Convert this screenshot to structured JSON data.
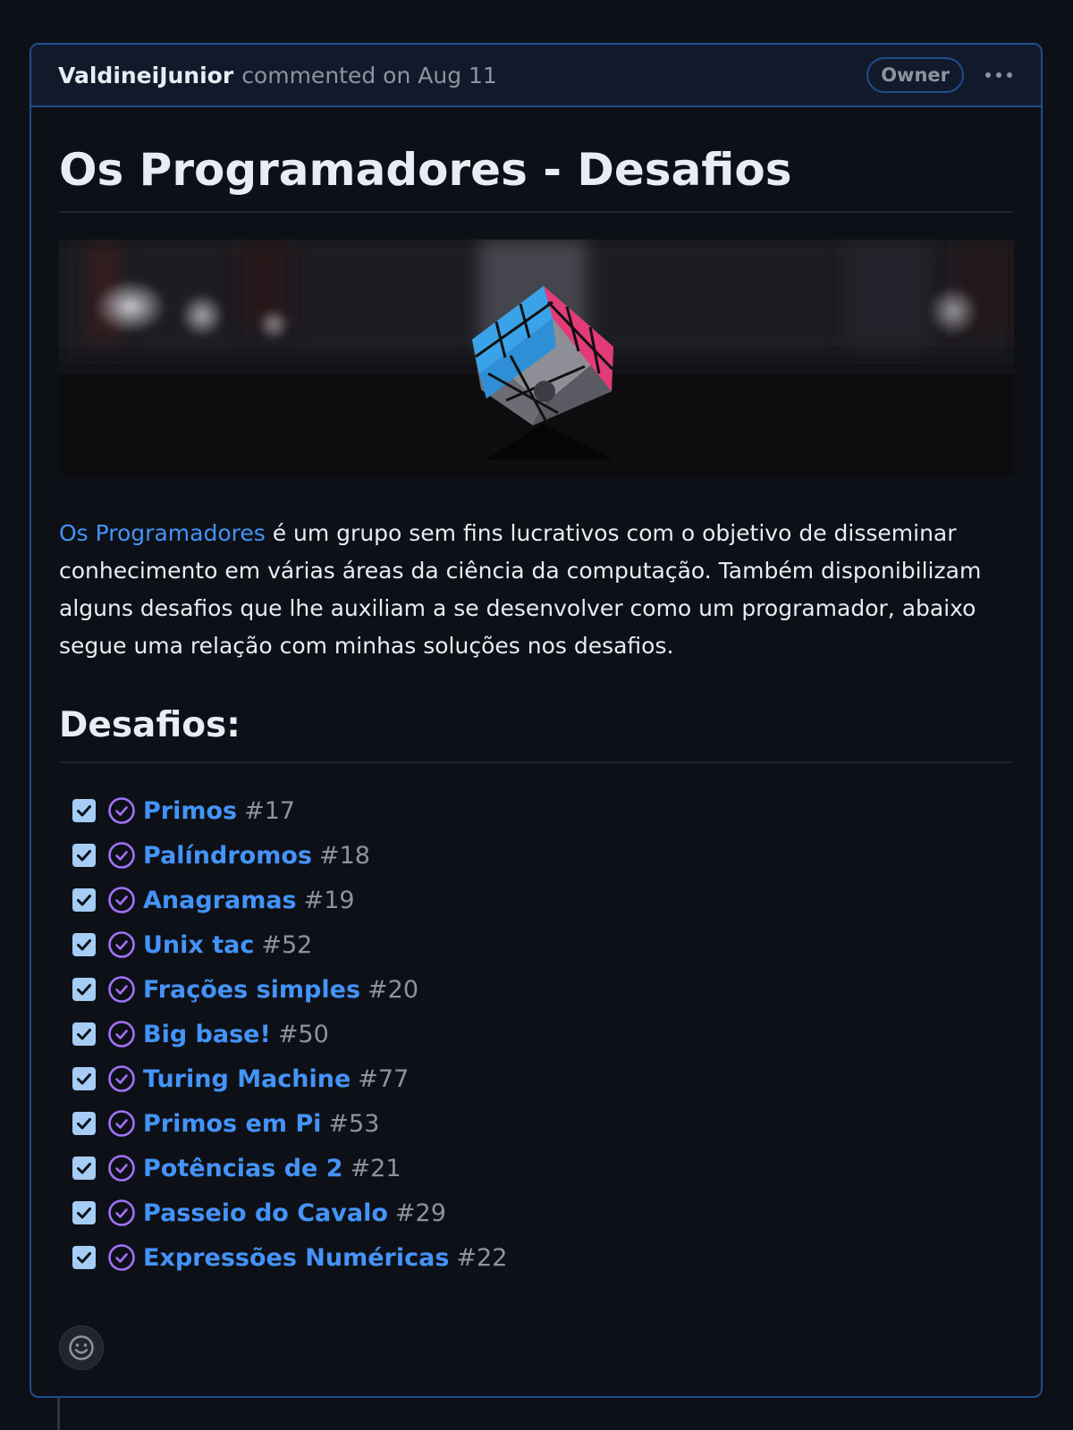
{
  "comment": {
    "author": "ValdineiJunior",
    "meta": "commented on Aug 11",
    "badge": "Owner",
    "more_icon": "kebab-horizontal-icon"
  },
  "content": {
    "title": "Os Programadores - Desafios",
    "hero_image": "rubiks-cube-photo",
    "intro_link": "Os Programadores",
    "intro_text": " é um grupo sem fins lucrativos com o objetivo de disseminar conhecimento em várias áreas da ciência da computação. Também disponibilizam alguns desafios que lhe auxiliam a se desenvolver como um programador, abaixo segue uma relação com minhas soluções nos desafios.",
    "section_title": "Desafios:"
  },
  "tasks": [
    {
      "title": "Primos",
      "number": "#17",
      "checked": true
    },
    {
      "title": "Palíndromos",
      "number": "#18",
      "checked": true
    },
    {
      "title": "Anagramas",
      "number": "#19",
      "checked": true
    },
    {
      "title": "Unix tac",
      "number": "#52",
      "checked": true
    },
    {
      "title": "Frações simples",
      "number": "#20",
      "checked": true
    },
    {
      "title": "Big base!",
      "number": "#50",
      "checked": true
    },
    {
      "title": "Turing Machine",
      "number": "#77",
      "checked": true
    },
    {
      "title": "Primos em Pi",
      "number": "#53",
      "checked": true
    },
    {
      "title": "Potências de 2",
      "number": "#21",
      "checked": true
    },
    {
      "title": "Passeio do Cavalo",
      "number": "#29",
      "checked": true
    },
    {
      "title": "Expressões Numéricas",
      "number": "#22",
      "checked": true
    }
  ],
  "colors": {
    "link": "#4493f8",
    "closed_issue": "#a371f7",
    "border": "#1f4d8f",
    "background": "#0d1117"
  },
  "reaction_icon": "smiley-icon"
}
